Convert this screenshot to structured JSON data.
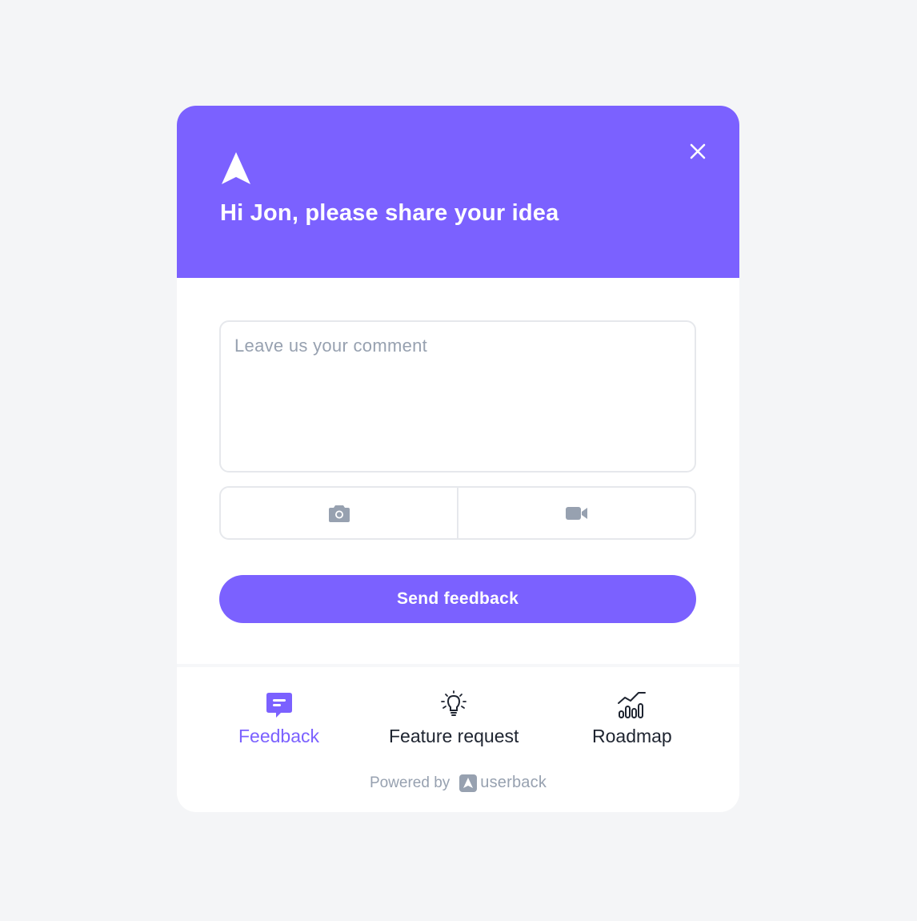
{
  "header": {
    "title": "Hi Jon, please share your idea",
    "logo_icon": "userback-arrow-icon",
    "close_icon": "close-icon",
    "background_color": "#7b61ff"
  },
  "form": {
    "comment_placeholder": "Leave us your comment",
    "comment_value": "",
    "capture_buttons": [
      {
        "icon": "camera-icon"
      },
      {
        "icon": "video-camera-icon"
      }
    ],
    "send_label": "Send feedback"
  },
  "bottom_nav": {
    "items": [
      {
        "label": "Feedback",
        "icon": "chat-message-icon",
        "active": true
      },
      {
        "label": "Feature request",
        "icon": "lightbulb-icon",
        "active": false
      },
      {
        "label": "Roadmap",
        "icon": "chart-trend-icon",
        "active": false
      }
    ]
  },
  "footer": {
    "powered_by": "Powered by",
    "brand_name": "userback"
  },
  "colors": {
    "accent": "#7b61ff",
    "muted": "#97a1b0",
    "text": "#1e2430",
    "border": "#e6e8ec"
  }
}
